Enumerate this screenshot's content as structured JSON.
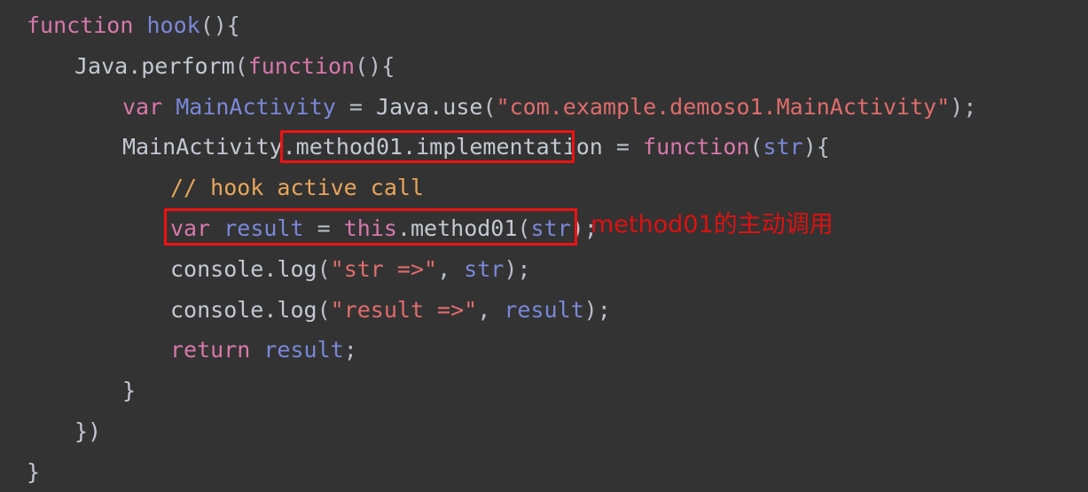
{
  "editor": {
    "background_color": "#333333",
    "default_text_color": "#c8cdd4",
    "language": "JavaScript (Frida hook script)",
    "lines": [
      {
        "indent": 0,
        "text": "function hook(){"
      },
      {
        "indent": 1,
        "text": "Java.perform(function(){"
      },
      {
        "indent": 2,
        "text": "var MainActivity = Java.use(\"com.example.demoso1.MainActivity\");"
      },
      {
        "indent": 2,
        "text": "MainActivity.method01.implementation = function(str){"
      },
      {
        "indent": 3,
        "text": "// hook active call"
      },
      {
        "indent": 3,
        "text": "var result = this.method01(str);"
      },
      {
        "indent": 3,
        "text": "console.log(\"str =>\", str);"
      },
      {
        "indent": 3,
        "text": "console.log(\"result =>\", result);"
      },
      {
        "indent": 3,
        "text": "return result;"
      },
      {
        "indent": 2,
        "text": "}"
      },
      {
        "indent": 1,
        "text": "})"
      },
      {
        "indent": 0,
        "text": "}"
      }
    ],
    "tokens": {
      "line1": {
        "kw": "function",
        "name": "hook",
        "punc": "(){"
      },
      "line2": {
        "plain": "Java.perform",
        "punc_open": "(",
        "kw": "function",
        "punc_rest": "(){"
      },
      "line3": {
        "kw": "var",
        "name": "MainActivity",
        "eq": "=",
        "plain": "Java.use",
        "punc_open": "(",
        "string": "\"com.example.demoso1.MainActivity\"",
        "punc_close": ");"
      },
      "line4": {
        "obj": "MainActivity.",
        "member": "method01.implementation",
        "eq": "=",
        "kw": "function",
        "punc_open": "(",
        "arg": "str",
        "punc_close": "){"
      },
      "line5": {
        "comment": "// hook active call"
      },
      "line6": {
        "kw": "var",
        "name": "result",
        "eq": "=",
        "kw2": "this",
        "dot": ".",
        "method": "method01",
        "punc_open": "(",
        "arg": "str",
        "punc_close": ");"
      },
      "line7": {
        "plain": "console.log",
        "punc_open": "(",
        "string": "\"str =>\"",
        "comma": ", ",
        "arg": "str",
        "punc_close": ");"
      },
      "line8": {
        "plain": "console.log",
        "punc_open": "(",
        "string": "\"result =>\"",
        "comma": ", ",
        "arg": "result",
        "punc_close": ");"
      },
      "line9": {
        "kw": "return",
        "name": "result",
        "punc": ";"
      },
      "line10": {
        "brace": "}"
      },
      "line11": {
        "brace": "})"
      },
      "line12": {
        "brace": "}"
      }
    },
    "colors": {
      "keyword": "#d778aa",
      "identifier": "#7a88d8",
      "plain": "#c3c9d1",
      "string": "#e06c6c",
      "comment": "#e8a55c",
      "punctuation": "#b9bfc7"
    }
  },
  "annotations": {
    "highlight_color": "#ee1111",
    "note_color": "#dd1111",
    "boxes": [
      {
        "target": "method01.implementation",
        "label": "implementation-highlight"
      },
      {
        "target": "var result = this.method01(str);",
        "label": "active-call-highlight"
      }
    ],
    "note_text": "method01的主动调用"
  }
}
